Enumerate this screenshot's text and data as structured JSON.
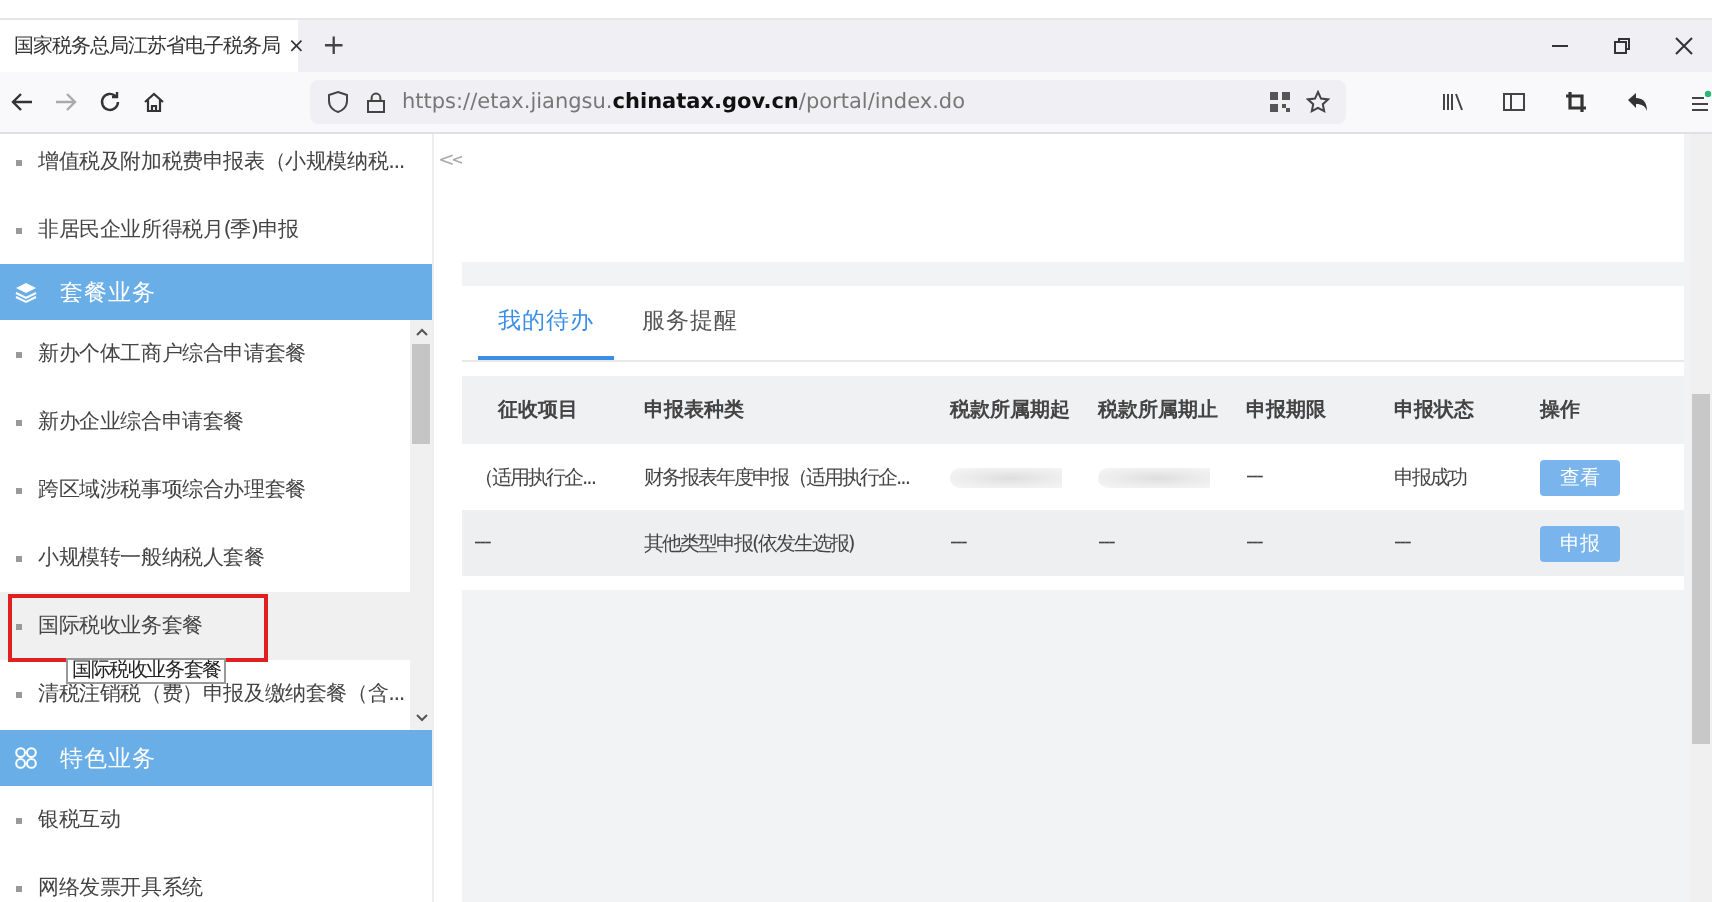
{
  "browser": {
    "tab_title": "国家税务总局江苏省电子税务局",
    "tab_close": "×",
    "new_tab": "+",
    "url": "https://etax.jiangsu.**chinatax.gov.cn**/portal/index.do"
  },
  "sidebar": {
    "collapse": "<<",
    "top_items": [
      {
        "text": "增值税及附加税费申报表（小规模纳税...",
        "highlighted": false
      },
      {
        "text": "非居民企业所得税月(季)申报",
        "highlighted": false
      }
    ],
    "groups": [
      {
        "title": "套餐业务",
        "scrollable": true,
        "items": [
          {
            "text": "新办个体工商户综合申请套餐",
            "highlighted": false
          },
          {
            "text": "新办企业综合申请套餐",
            "highlighted": false
          },
          {
            "text": "跨区域涉税事项综合办理套餐",
            "highlighted": false
          },
          {
            "text": "小规模转一般纳税人套餐",
            "highlighted": false
          },
          {
            "text": "国际税收业务套餐",
            "highlighted": true,
            "tooltip": "国际税收业务套餐"
          },
          {
            "text": "清税注销税（费）申报及缴纳套餐（含...",
            "highlighted": false
          }
        ]
      },
      {
        "title": "特色业务",
        "scrollable": false,
        "items": [
          {
            "text": "银税互动",
            "highlighted": false
          },
          {
            "text": "网络发票开具系统",
            "highlighted": false
          }
        ]
      }
    ]
  },
  "tabs": [
    {
      "label": "我的待办",
      "selected": true
    },
    {
      "label": "服务提醒",
      "selected": false
    }
  ],
  "table": {
    "columns": [
      "征收项目",
      "申报表种类",
      "税款所属期起",
      "税款所属期止",
      "申报期限",
      "申报状态",
      "操作"
    ],
    "rows": [
      {
        "cells": [
          {
            "kind": "text",
            "text": "（适用执行企..."
          },
          {
            "kind": "text",
            "text": "财务报表年度申报（适用执行企..."
          },
          {
            "kind": "redacted"
          },
          {
            "kind": "redacted"
          },
          {
            "kind": "text",
            "text": "---"
          },
          {
            "kind": "text",
            "text": "申报成功"
          },
          {
            "kind": "button",
            "text": "查看"
          }
        ]
      },
      {
        "cells": [
          {
            "kind": "text",
            "text": "---"
          },
          {
            "kind": "text",
            "text": "其他类型申报(依发生选报)"
          },
          {
            "kind": "text",
            "text": "---"
          },
          {
            "kind": "text",
            "text": "---"
          },
          {
            "kind": "text",
            "text": "---"
          },
          {
            "kind": "text",
            "text": "---"
          },
          {
            "kind": "button",
            "text": "申报"
          }
        ]
      }
    ]
  }
}
